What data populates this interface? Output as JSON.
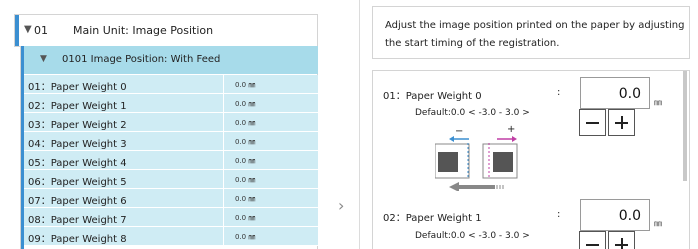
{
  "main_unit": {
    "code": "01",
    "title": "Main Unit: Image Position"
  },
  "sub_group": {
    "label": "0101 Image Position: With Feed"
  },
  "rows": [
    {
      "name": "01：Paper Weight 0",
      "value": "0.0 ㎜"
    },
    {
      "name": "02：Paper Weight 1",
      "value": "0.0 ㎜"
    },
    {
      "name": "03：Paper Weight 2",
      "value": "0.0 ㎜"
    },
    {
      "name": "04：Paper Weight 3",
      "value": "0.0 ㎜"
    },
    {
      "name": "05：Paper Weight 4",
      "value": "0.0 ㎜"
    },
    {
      "name": "06：Paper Weight 5",
      "value": "0.0 ㎜"
    },
    {
      "name": "07：Paper Weight 6",
      "value": "0.0 ㎜"
    },
    {
      "name": "08：Paper Weight 7",
      "value": "0.0 ㎜"
    },
    {
      "name": "09：Paper Weight 8",
      "value": "0.0 ㎜"
    }
  ],
  "description": {
    "line1": "Adjust the image position printed on the paper by adjusting",
    "line2": "the start timing of the registration."
  },
  "settings": [
    {
      "name": "01：Paper Weight 0",
      "value": "0.0",
      "unit": "㎜",
      "default": "Default:0.0  < -3.0  -  3.0 >"
    },
    {
      "name": "02：Paper Weight 1",
      "value": "0.0",
      "unit": "㎜",
      "default": "Default:0.0  < -3.0  -  3.0 >"
    }
  ],
  "colon": ":",
  "diagram": {
    "minus_label": "−",
    "plus_label": "+"
  },
  "colors": {
    "accent": "#3b8fd1",
    "sub_header": "#a7dbea",
    "row_bg": "#cfecf4",
    "arrow_blue": "#3b8fd1",
    "arrow_pink": "#c03fa5"
  }
}
